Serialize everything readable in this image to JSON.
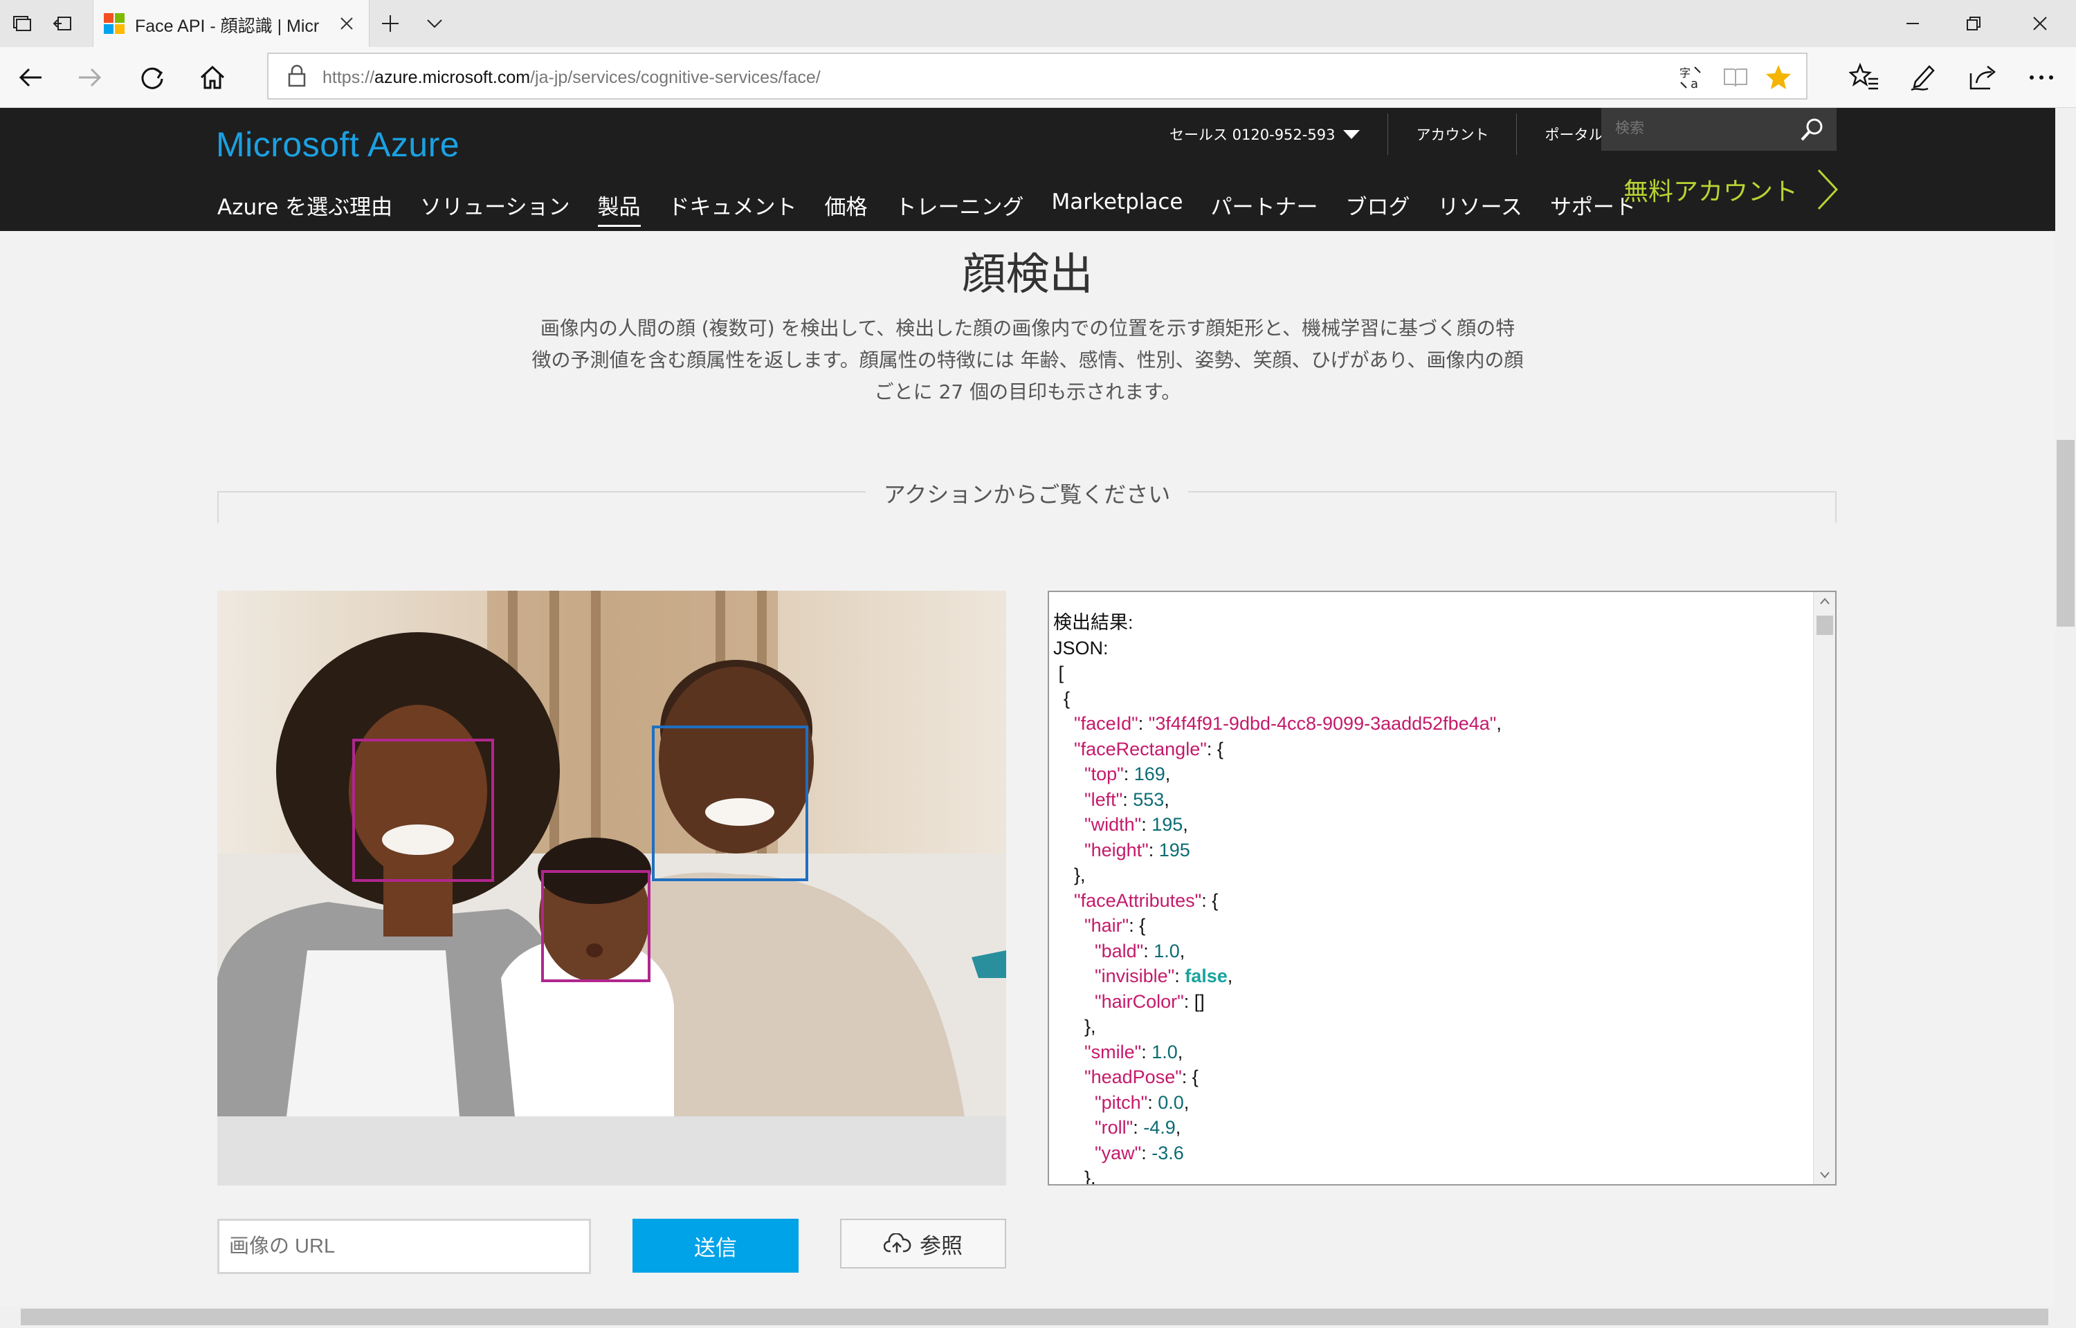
{
  "browser": {
    "tab_title": "Face API - 顔認識 | Micr",
    "url_prefix": "https://",
    "url_domain": "azure.microsoft.com",
    "url_path": "/ja-jp/services/cognitive-services/face/"
  },
  "header": {
    "brand": "Microsoft Azure",
    "util_links": [
      "セールス 0120-952-593",
      "アカウント",
      "ポータル"
    ],
    "search_placeholder": "検索",
    "nav": [
      "Azure を選ぶ理由",
      "ソリューション",
      "製品",
      "ドキュメント",
      "価格",
      "トレーニング",
      "Marketplace",
      "パートナー",
      "ブログ",
      "リソース",
      "サポート"
    ],
    "active_nav": "製品",
    "free_account": "無料アカウント"
  },
  "main": {
    "title": "顔検出",
    "description_lines": [
      "画像内の人間の顔 (複数可) を検出して、検出した顔の画像内での位置を示す顔矩形と、機械学習に基づく顔の特",
      "徴の予測値を含む顔属性を返します。顔属性の特徴には 年齢、感情、性別、姿勢、笑顔、ひげがあり、画像内の顔",
      "ごとに 27 個の目印も示されます。"
    ],
    "action_heading": "アクションからご覧ください"
  },
  "result": {
    "label_result": "検出結果:",
    "label_json": "JSON:",
    "face_id": "3f4f4f91-9dbd-4cc8-9099-3aadd52fbe4a",
    "top": "169",
    "left": "553",
    "width": "195",
    "height": "195",
    "bald": "1.0",
    "invisible": "false",
    "smile": "1.0",
    "pitch": "0.0",
    "roll": "-4.9",
    "yaw": "-3.6"
  },
  "controls": {
    "url_placeholder": "画像の URL",
    "send_label": "送信",
    "browse_label": "参照"
  },
  "colors": {
    "face_box_magenta": "#b0278e",
    "face_box_blue": "#1f6fc0",
    "accent_blue": "#00a2e8",
    "free_account_green": "#b8d432"
  }
}
